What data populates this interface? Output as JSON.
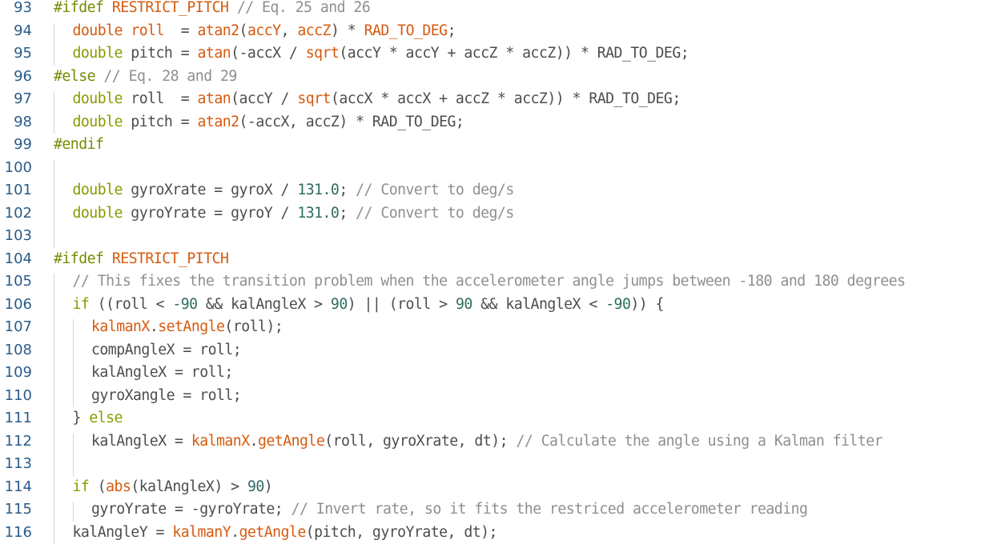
{
  "editor": {
    "lines": [
      {
        "num": "93",
        "indent": 0,
        "tokens": [
          [
            "pp",
            "#ifdef"
          ],
          [
            "id",
            " "
          ],
          [
            "mac",
            "RESTRICT_PITCH"
          ],
          [
            "id",
            " "
          ],
          [
            "cm",
            "// Eq. 25 and 26"
          ]
        ]
      },
      {
        "num": "94",
        "indent": 1,
        "tokens": [
          [
            "fn",
            "double"
          ],
          [
            "id",
            " "
          ],
          [
            "fn",
            "roll"
          ],
          [
            "id",
            "  = "
          ],
          [
            "fn",
            "atan2"
          ],
          [
            "id",
            "("
          ],
          [
            "fn",
            "accY"
          ],
          [
            "id",
            ", "
          ],
          [
            "fn",
            "accZ"
          ],
          [
            "id",
            ") * "
          ],
          [
            "mac",
            "RAD_TO_DEG"
          ],
          [
            "id",
            ";"
          ]
        ]
      },
      {
        "num": "95",
        "indent": 1,
        "tokens": [
          [
            "kw",
            "double"
          ],
          [
            "id",
            " pitch = "
          ],
          [
            "fn",
            "atan"
          ],
          [
            "id",
            "(-accX / "
          ],
          [
            "fn",
            "sqrt"
          ],
          [
            "id",
            "(accY * accY + accZ * accZ)) * RAD_TO_DEG;"
          ]
        ]
      },
      {
        "num": "96",
        "indent": 0,
        "tokens": [
          [
            "pp",
            "#else"
          ],
          [
            "id",
            " "
          ],
          [
            "cm",
            "// Eq. 28 and 29"
          ]
        ]
      },
      {
        "num": "97",
        "indent": 1,
        "tokens": [
          [
            "kw",
            "double"
          ],
          [
            "id",
            " roll  = "
          ],
          [
            "fn",
            "atan"
          ],
          [
            "id",
            "(accY / "
          ],
          [
            "fn",
            "sqrt"
          ],
          [
            "id",
            "(accX * accX + accZ * accZ)) * RAD_TO_DEG;"
          ]
        ]
      },
      {
        "num": "98",
        "indent": 1,
        "tokens": [
          [
            "kw",
            "double"
          ],
          [
            "id",
            " pitch = "
          ],
          [
            "fn",
            "atan2"
          ],
          [
            "id",
            "(-accX, accZ) * RAD_TO_DEG;"
          ]
        ]
      },
      {
        "num": "99",
        "indent": 0,
        "tokens": [
          [
            "pp",
            "#endif"
          ]
        ]
      },
      {
        "num": "100",
        "indent": 0,
        "tokens": []
      },
      {
        "num": "101",
        "indent": 1,
        "tokens": [
          [
            "kw",
            "double"
          ],
          [
            "id",
            " gyroXrate = gyroX / "
          ],
          [
            "nm",
            "131.0"
          ],
          [
            "id",
            "; "
          ],
          [
            "cm",
            "// Convert to deg/s"
          ]
        ]
      },
      {
        "num": "102",
        "indent": 1,
        "tokens": [
          [
            "kw",
            "double"
          ],
          [
            "id",
            " gyroYrate = gyroY / "
          ],
          [
            "nm",
            "131.0"
          ],
          [
            "id",
            "; "
          ],
          [
            "cm",
            "// Convert to deg/s"
          ]
        ]
      },
      {
        "num": "103",
        "indent": 0,
        "tokens": []
      },
      {
        "num": "104",
        "indent": 0,
        "tokens": [
          [
            "pp",
            "#ifdef"
          ],
          [
            "id",
            " "
          ],
          [
            "mac",
            "RESTRICT_PITCH"
          ]
        ]
      },
      {
        "num": "105",
        "indent": 1,
        "tokens": [
          [
            "cm",
            "// This fixes the transition problem when the accelerometer angle jumps between -180 and 180 degrees"
          ]
        ]
      },
      {
        "num": "106",
        "indent": 1,
        "tokens": [
          [
            "kw",
            "if"
          ],
          [
            "id",
            " ((roll < "
          ],
          [
            "nm",
            "-90"
          ],
          [
            "id",
            " && kalAngleX > "
          ],
          [
            "nm",
            "90"
          ],
          [
            "id",
            ") || (roll > "
          ],
          [
            "nm",
            "90"
          ],
          [
            "id",
            " && kalAngleX < "
          ],
          [
            "nm",
            "-90"
          ],
          [
            "id",
            ")) {"
          ]
        ]
      },
      {
        "num": "107",
        "indent": 2,
        "tokens": [
          [
            "fn",
            "kalmanX"
          ],
          [
            "id",
            "."
          ],
          [
            "fn",
            "setAngle"
          ],
          [
            "id",
            "(roll);"
          ]
        ]
      },
      {
        "num": "108",
        "indent": 2,
        "tokens": [
          [
            "id",
            "compAngleX = roll;"
          ]
        ]
      },
      {
        "num": "109",
        "indent": 2,
        "tokens": [
          [
            "id",
            "kalAngleX = roll;"
          ]
        ]
      },
      {
        "num": "110",
        "indent": 2,
        "tokens": [
          [
            "id",
            "gyroXangle = roll;"
          ]
        ]
      },
      {
        "num": "111",
        "indent": 1,
        "tokens": [
          [
            "id",
            "} "
          ],
          [
            "kw",
            "else"
          ]
        ]
      },
      {
        "num": "112",
        "indent": 2,
        "tokens": [
          [
            "id",
            "kalAngleX = "
          ],
          [
            "fn",
            "kalmanX"
          ],
          [
            "id",
            "."
          ],
          [
            "fn",
            "getAngle"
          ],
          [
            "id",
            "(roll, gyroXrate, dt); "
          ],
          [
            "cm",
            "// Calculate the angle using a Kalman filter"
          ]
        ]
      },
      {
        "num": "113",
        "indent": 0,
        "tokens": []
      },
      {
        "num": "114",
        "indent": 1,
        "tokens": [
          [
            "kw",
            "if"
          ],
          [
            "id",
            " ("
          ],
          [
            "fn",
            "abs"
          ],
          [
            "id",
            "(kalAngleX) > "
          ],
          [
            "nm",
            "90"
          ],
          [
            "id",
            ")"
          ]
        ]
      },
      {
        "num": "115",
        "indent": 2,
        "tokens": [
          [
            "id",
            "gyroYrate = -gyroYrate; "
          ],
          [
            "cm",
            "// Invert rate, so it fits the restriced accelerometer reading"
          ]
        ]
      },
      {
        "num": "116",
        "indent": 1,
        "tokens": [
          [
            "id",
            "kalAngleY = "
          ],
          [
            "fn",
            "kalmanY"
          ],
          [
            "id",
            "."
          ],
          [
            "fn",
            "getAngle"
          ],
          [
            "id",
            "(pitch, gyroYrate, dt);"
          ]
        ]
      }
    ]
  }
}
